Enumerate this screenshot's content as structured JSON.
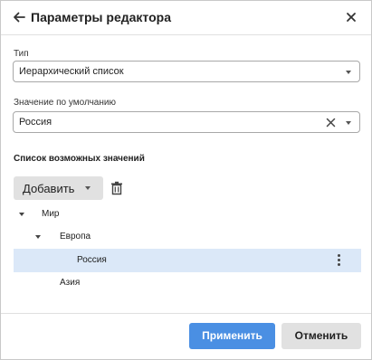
{
  "dialog": {
    "title": "Параметры редактора",
    "back_icon": "arrow-left-icon",
    "close_icon": "close-icon"
  },
  "type_field": {
    "label": "Тип",
    "value": "Иерархический список",
    "icon": "chevron-down-icon"
  },
  "default_field": {
    "label": "Значение по умолчанию",
    "value": "Россия",
    "clear_icon": "close-icon",
    "icon": "chevron-down-icon"
  },
  "values_section": {
    "title": "Список возможных значений",
    "add_label": "Добавить",
    "delete_icon": "trash-icon"
  },
  "tree": {
    "items": [
      {
        "label": "Мир",
        "expanded": true,
        "selected": false
      },
      {
        "label": "Европа",
        "expanded": true,
        "selected": false
      },
      {
        "label": "Россия",
        "expanded": false,
        "selected": true
      },
      {
        "label": "Азия",
        "expanded": false,
        "selected": false
      }
    ],
    "more_icon": "more-vertical-icon"
  },
  "footer": {
    "apply_label": "Применить",
    "cancel_label": "Отменить"
  },
  "colors": {
    "accent": "#4a8fe3",
    "selected_row": "#dbe8f8",
    "button_gray": "#e1e1e1"
  }
}
